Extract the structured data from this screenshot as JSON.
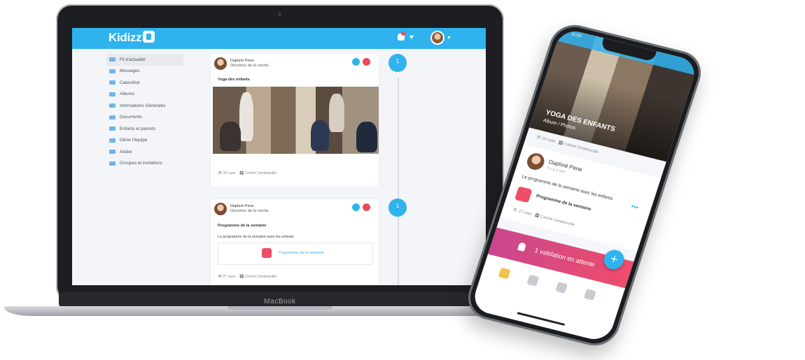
{
  "app": {
    "brand": "Kidizz",
    "laptop_label": "MacBook"
  },
  "sidebar": {
    "items": [
      {
        "label": "Fil d'actualité",
        "icon": "news-icon",
        "active": true
      },
      {
        "label": "Messages",
        "icon": "messages-icon"
      },
      {
        "label": "Calendrier",
        "icon": "calendar-icon"
      },
      {
        "label": "Albums",
        "icon": "albums-icon"
      },
      {
        "label": "Informations Générales",
        "icon": "info-icon"
      },
      {
        "label": "Documents",
        "icon": "documents-icon"
      },
      {
        "label": "Enfants et parents",
        "icon": "family-icon"
      },
      {
        "label": "Gérer l'équipe",
        "icon": "team-icon"
      },
      {
        "label": "Atelier",
        "icon": "workshop-icon"
      },
      {
        "label": "Groupes et invitations",
        "icon": "groups-icon"
      }
    ]
  },
  "feed": {
    "posts": [
      {
        "author": "Daphné Pene",
        "role": "Directrice de la crèche",
        "title": "Yoga des enfants",
        "views": "20 vues",
        "shared": "Crèche Cerdebouille",
        "timeline_count": "1",
        "timeline_unit": "mai"
      },
      {
        "author": "Daphné Pene",
        "role": "Directrice de la crèche",
        "title": "Programme de la semaine",
        "text": "Le programme de la semaine avec les enfants",
        "attachment": "Programme de la semaine",
        "views": "27 vues",
        "shared": "Crèche Cerdebouille",
        "timeline_count": "1",
        "timeline_unit": "mai"
      }
    ]
  },
  "phone": {
    "status_time": "11:03",
    "hero_title": "YOGA DES ENFANTS",
    "hero_subtitle": "Album / Photos",
    "hero_views": "20 vues",
    "hero_shared": "Crèche Cerdebouille",
    "post_author": "Daphné Pene",
    "post_time": "Il y a 1 min",
    "post_text": "Le programme de la semaine avec les enfants",
    "post_attachment": "Programme de la semaine",
    "post_views": "27 vues",
    "post_shared": "Crèche Cerdebouille",
    "pending": "1 validation en attente",
    "fab": "+"
  },
  "colors": {
    "accent": "#2eb3ee",
    "danger": "#e94b5b",
    "pink": "#ef4d6a"
  }
}
